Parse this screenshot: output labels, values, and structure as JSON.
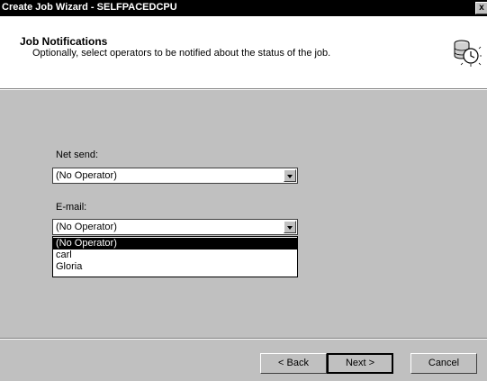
{
  "window": {
    "title": "Create Job Wizard - SELFPACEDCPU",
    "close_label": "x"
  },
  "header": {
    "title": "Job Notifications",
    "subtitle": "Optionally, select operators to be notified about the status of the job.",
    "icon": "clock-database-icon"
  },
  "form": {
    "net_send": {
      "label": "Net send:",
      "value": "(No Operator)"
    },
    "email": {
      "label": "E-mail:",
      "value": "(No Operator)",
      "options": [
        "(No Operator)",
        "carl",
        "Gloria"
      ],
      "highlighted_index": 0
    }
  },
  "buttons": {
    "back": "< Back",
    "next": "Next >",
    "cancel": "Cancel"
  },
  "colors": {
    "titlebar": "#000000",
    "dialog_bg": "#c0c0c0",
    "highlight": "#000000"
  }
}
